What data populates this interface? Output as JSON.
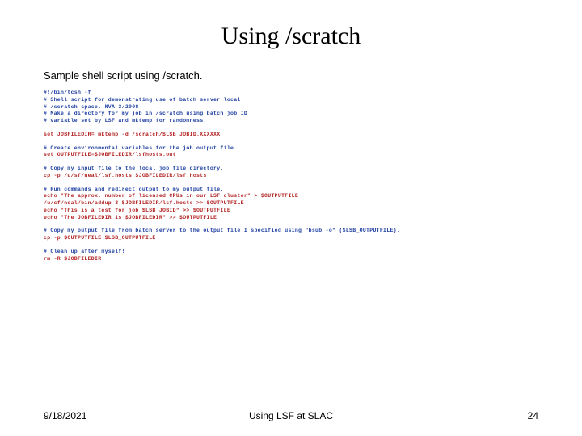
{
  "title": "Using /scratch",
  "subtitle": "Sample shell script using /scratch.",
  "code": {
    "c1": "#!/bin/tcsh -f",
    "c2": "# Shell script for demonstrating use of batch server local",
    "c3": "# /scratch space. NVA 3/2008",
    "c4": "# Make a directory for my job in /scratch using batch job ID",
    "c5": "# variable set by LSF and mktemp for randomness.",
    "c6": "set JOBFILEDIR=`mktemp -d /scratch/$LSB_JOBID.XXXXXX`",
    "c7": "# Create environmental variables for the job output file.",
    "c8": "set OUTPUTFILE=$JOBFILEDIR/lsfhosts.out",
    "c9": "# Copy my input file to the local job file directory.",
    "c10": "cp -p /u/sf/neal/lsf.hosts $JOBFILEDIR/lsf.hosts",
    "c11": "# Run commands and redirect output to my output file.",
    "c12": "echo \"The approx. number of licensed CPUs in our LSF cluster\" > $OUTPUTFILE",
    "c13": "/u/sf/neal/bin/addup 3 $JOBFILEDIR/lsf.hosts >> $OUTPUTFILE",
    "c14": "echo \"This is a test for job $LSB_JOBID\" >> $OUTPUTFILE",
    "c15": "echo \"The JOBFILEDIR is $JOBFILEDIR\" >> $OUTPUTFILE",
    "c16": "# Copy my output file from batch server to the output file I specified using \"bsub -o\" ($LSB_OUTPUTFILE).",
    "c17": "cp -p $OUTPUTFILE $LSB_OUTPUTFILE",
    "c18": "# Clean up after myself!",
    "c19": "rm -R $JOBFILEDIR"
  },
  "footer": {
    "date": "9/18/2021",
    "center": "Using LSF at SLAC",
    "page": "24"
  }
}
